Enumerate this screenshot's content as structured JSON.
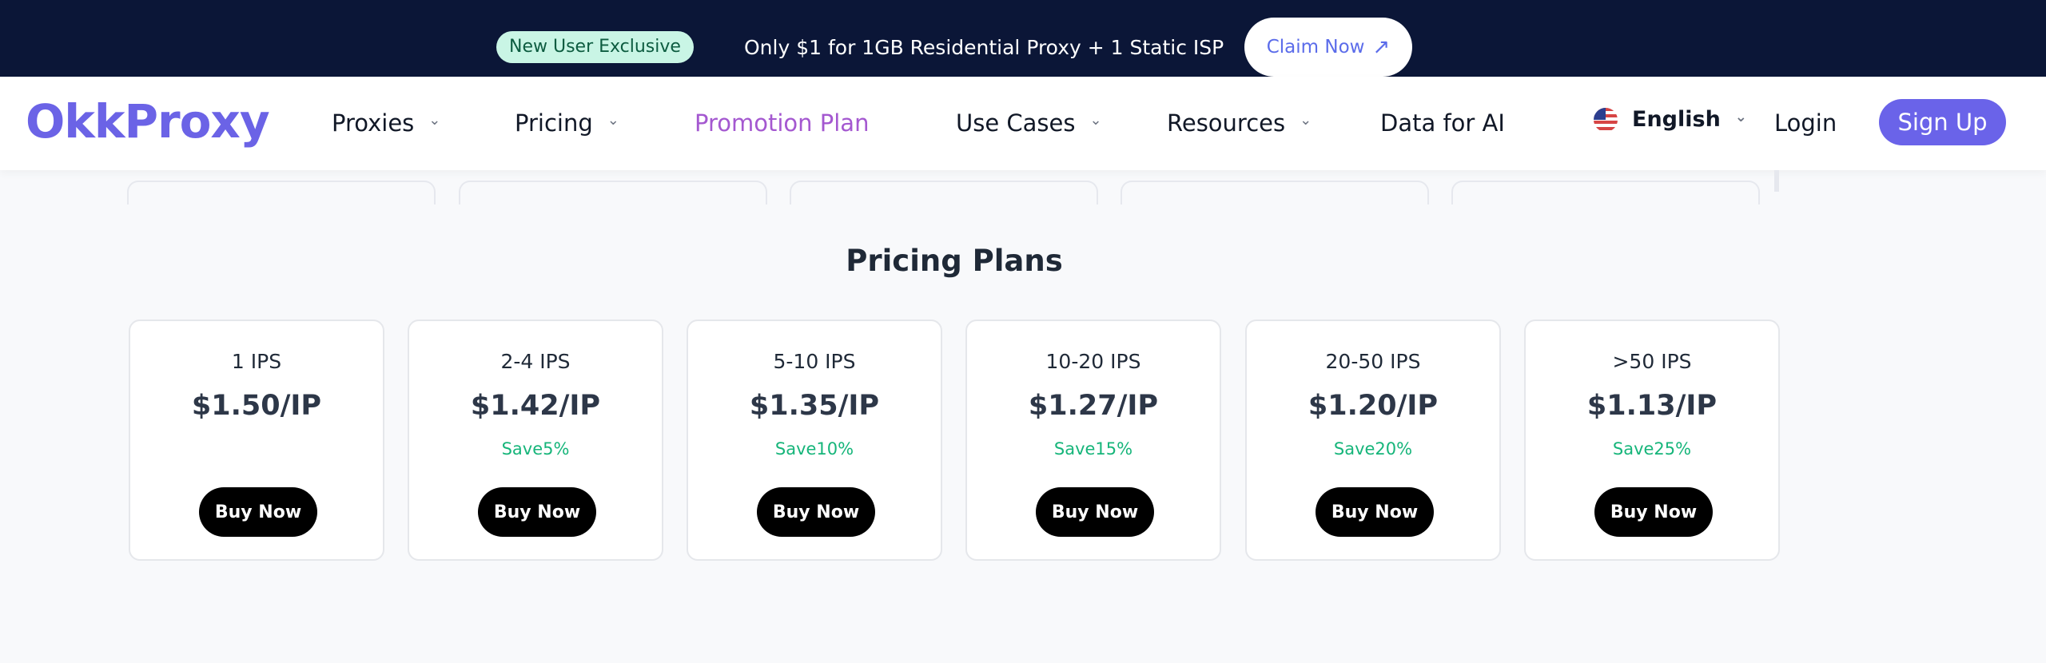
{
  "promo": {
    "badge": "New User Exclusive",
    "text": "Only $1 for 1GB Residential Proxy + 1 Static ISP",
    "claim_label": "Claim Now",
    "claim_icon": "arrow-up-right-icon"
  },
  "header": {
    "logo": "OkkProxy",
    "nav": [
      "Proxies",
      "Pricing",
      "Promotion Plan",
      "Use Cases",
      "Resources",
      "Data for AI"
    ],
    "language": "English",
    "login": "Login",
    "signup": "Sign Up"
  },
  "section": {
    "title": "Pricing Plans"
  },
  "plans": [
    {
      "ips": "1 IPS",
      "price": "$1.50/IP",
      "save": "",
      "button": "Buy Now"
    },
    {
      "ips": "2-4 IPS",
      "price": "$1.42/IP",
      "save": "Save5%",
      "button": "Buy Now"
    },
    {
      "ips": "5-10 IPS",
      "price": "$1.35/IP",
      "save": "Save10%",
      "button": "Buy Now"
    },
    {
      "ips": "10-20 IPS",
      "price": "$1.27/IP",
      "save": "Save15%",
      "button": "Buy Now"
    },
    {
      "ips": "20-50 IPS",
      "price": "$1.20/IP",
      "save": "Save20%",
      "button": "Buy Now"
    },
    {
      "ips": ">50 IPS",
      "price": "$1.13/IP",
      "save": "Save25%",
      "button": "Buy Now"
    }
  ],
  "colors": {
    "brand": "#6a63e9",
    "promo_bg": "#0b1637",
    "active_nav": "#a458d0",
    "save_green": "#16b57a"
  }
}
